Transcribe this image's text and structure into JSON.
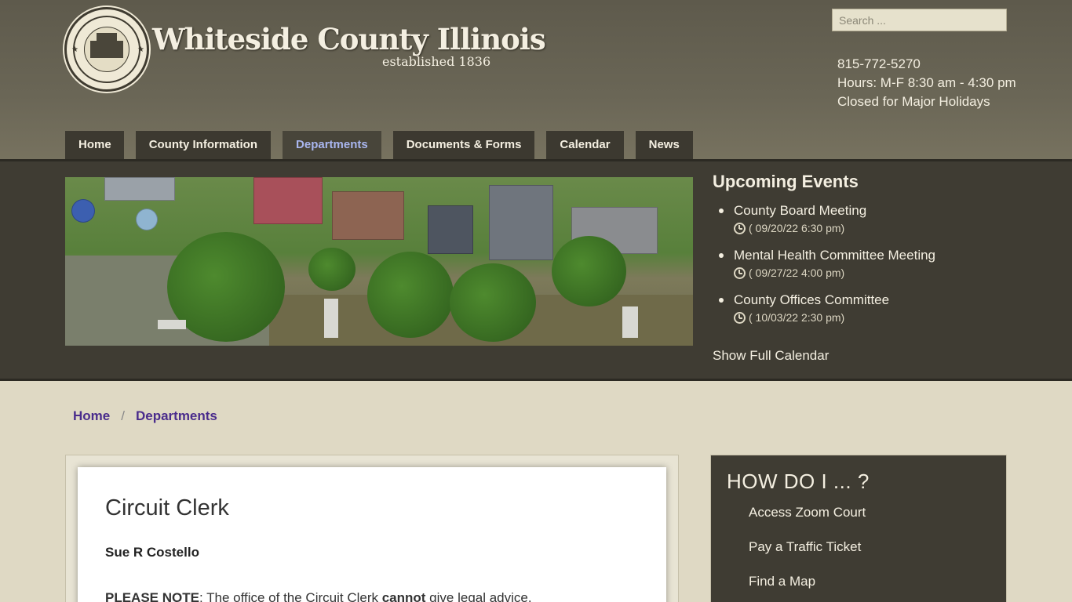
{
  "header": {
    "title": "Whiteside County Illinois",
    "subtitle": "established 1836",
    "seal_text": "Whiteside County Illinois 1836",
    "search_placeholder": "Search ...",
    "phone": "815-772-5270",
    "hours": "Hours: M-F 8:30 am - 4:30 pm",
    "closed": "Closed for Major Holidays"
  },
  "nav": {
    "items": [
      "Home",
      "County Information",
      "Departments",
      "Documents & Forms",
      "Calendar",
      "News"
    ],
    "active": "Departments"
  },
  "events": {
    "heading": "Upcoming Events",
    "items": [
      {
        "title": "County Board Meeting",
        "date": "( 09/20/22 6:30 pm)"
      },
      {
        "title": "Mental Health Committee Meeting",
        "date": "( 09/27/22 4:00 pm)"
      },
      {
        "title": "County Offices Committee",
        "date": "( 10/03/22 2:30 pm)"
      }
    ],
    "show_full": "Show Full Calendar"
  },
  "breadcrumb": {
    "items": [
      "Home",
      "Departments"
    ],
    "separator": "/"
  },
  "main": {
    "title": "Circuit Clerk",
    "person": "Sue R Costello",
    "note_label": "PLEASE NOTE",
    "note_text_1": ": The office of the Circuit Clerk ",
    "note_emphasis": "cannot",
    "note_text_2": " give legal advice."
  },
  "sidebar": {
    "heading": "HOW DO I ... ?",
    "links": [
      "Access Zoom Court",
      "Pay a Traffic Ticket",
      "Find a Map"
    ]
  }
}
